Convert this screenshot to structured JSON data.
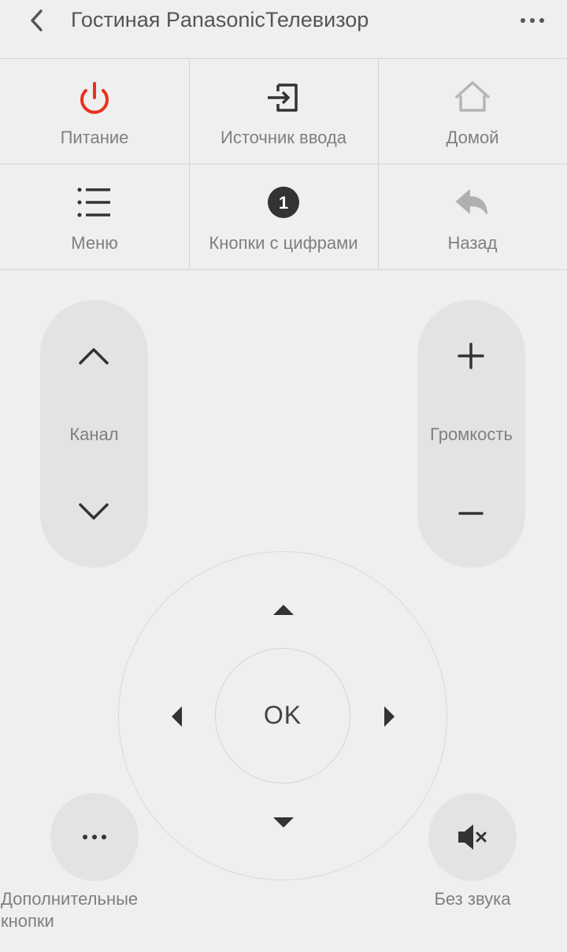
{
  "header": {
    "title": "Гостиная PanasonicТелевизор",
    "back_icon": "chevron-left-icon",
    "more_icon": "more-horizontal-icon"
  },
  "grid": {
    "items": [
      {
        "label": "Питание",
        "icon": "power-icon",
        "color": "#e8321f"
      },
      {
        "label": "Источник ввода",
        "icon": "input-source-icon"
      },
      {
        "label": "Домой",
        "icon": "home-icon"
      },
      {
        "label": "Меню",
        "icon": "menu-list-icon"
      },
      {
        "label": "Кнопки с цифрами",
        "icon": "number-one-icon",
        "badge": "1"
      },
      {
        "label": "Назад",
        "icon": "return-icon"
      }
    ]
  },
  "channel": {
    "label": "Канал",
    "up_icon": "chevron-up-icon",
    "down_icon": "chevron-down-icon"
  },
  "volume": {
    "label": "Громкость",
    "up_icon": "plus-icon",
    "down_icon": "minus-icon"
  },
  "dpad": {
    "ok_label": "OK"
  },
  "extra": {
    "line1": "Дополнительные",
    "line2": "кнопки",
    "icon": "more-horizontal-icon"
  },
  "mute": {
    "label": "Без звука",
    "icon": "mute-icon"
  }
}
